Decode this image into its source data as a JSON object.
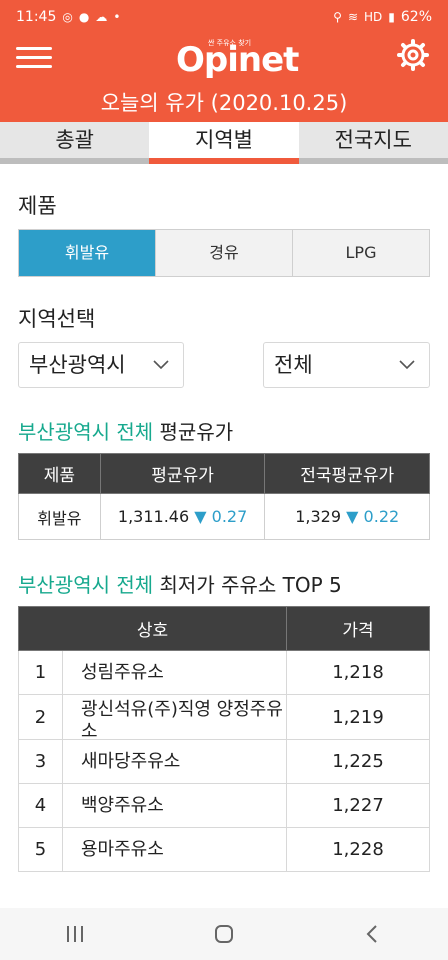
{
  "status_bar": {
    "time": "11:45",
    "battery": "62%",
    "network": "HD"
  },
  "header": {
    "logo_text": "Opinet",
    "logo_tagline": "싼 주유소 찾기"
  },
  "title": "오늘의 유가 (2020.10.25)",
  "tabs": [
    {
      "label": "총괄"
    },
    {
      "label": "지역별"
    },
    {
      "label": "전국지도"
    }
  ],
  "product": {
    "label": "제품",
    "options": [
      {
        "label": "휘발유"
      },
      {
        "label": "경유"
      },
      {
        "label": "LPG"
      }
    ]
  },
  "region": {
    "label": "지역선택",
    "city": "부산광역시",
    "district": "전체"
  },
  "average": {
    "heading_highlight": "부산광역시 전체",
    "heading_rest": " 평균유가",
    "columns": [
      "제품",
      "평균유가",
      "전국평균유가"
    ],
    "row": {
      "product": "휘발유",
      "avg_price": "1,311.46",
      "avg_change": "0.27",
      "national_price": "1,329",
      "national_change": "0.22"
    }
  },
  "top5": {
    "heading_highlight": "부산광역시 전체",
    "heading_rest": " 최저가 주유소 TOP 5",
    "columns": [
      "상호",
      "가격"
    ],
    "rows": [
      {
        "rank": "1",
        "name": "성림주유소",
        "price": "1,218"
      },
      {
        "rank": "2",
        "name": "광신석유(주)직영 양정주유소",
        "price": "1,219"
      },
      {
        "rank": "3",
        "name": "새마당주유소",
        "price": "1,225"
      },
      {
        "rank": "4",
        "name": "백양주유소",
        "price": "1,227"
      },
      {
        "rank": "5",
        "name": "용마주유소",
        "price": "1,228"
      }
    ]
  },
  "colors": {
    "brand": "#f05a3c",
    "accent": "#2d9ec9",
    "highlight": "#17a98e"
  }
}
